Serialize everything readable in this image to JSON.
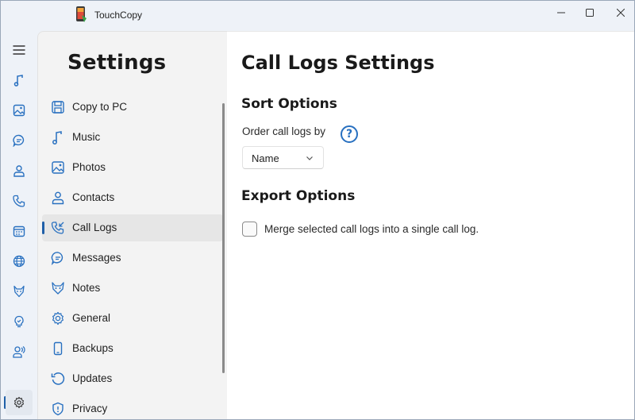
{
  "window": {
    "title": "TouchCopy"
  },
  "rail": {
    "items": [
      {
        "icon": "hamburger-menu-icon"
      },
      {
        "icon": "music-icon"
      },
      {
        "icon": "photos-icon"
      },
      {
        "icon": "messages-icon"
      },
      {
        "icon": "contacts-icon"
      },
      {
        "icon": "call-logs-icon"
      },
      {
        "icon": "calendar-icon"
      },
      {
        "icon": "internet-icon"
      },
      {
        "icon": "notes-icon"
      },
      {
        "icon": "tips-icon"
      },
      {
        "icon": "voice-icon"
      },
      {
        "icon": "settings-gear-icon"
      }
    ]
  },
  "nav": {
    "title": "Settings",
    "items": [
      {
        "label": "Copy to PC",
        "icon": "copy-to-pc-icon"
      },
      {
        "label": "Music",
        "icon": "music-icon"
      },
      {
        "label": "Photos",
        "icon": "photos-icon"
      },
      {
        "label": "Contacts",
        "icon": "contacts-icon"
      },
      {
        "label": "Call Logs",
        "icon": "call-logs-icon",
        "selected": true
      },
      {
        "label": "Messages",
        "icon": "messages-icon"
      },
      {
        "label": "Notes",
        "icon": "notes-icon"
      },
      {
        "label": "General",
        "icon": "gear-icon"
      },
      {
        "label": "Backups",
        "icon": "phone-icon"
      },
      {
        "label": "Updates",
        "icon": "refresh-icon"
      },
      {
        "label": "Privacy",
        "icon": "shield-icon"
      }
    ]
  },
  "content": {
    "title": "Call Logs Settings",
    "sort_section": {
      "title": "Sort Options",
      "order_label": "Order call logs by",
      "order_value": "Name"
    },
    "export_section": {
      "title": "Export Options",
      "merge_label": "Merge selected call logs into a single call log.",
      "merge_checked": false
    }
  },
  "colors": {
    "accent": "#2870c0",
    "indicator": "#1f5fa8",
    "background": "#eef2f8",
    "nav_panel": "#f3f3f3",
    "content": "#ffffff"
  }
}
